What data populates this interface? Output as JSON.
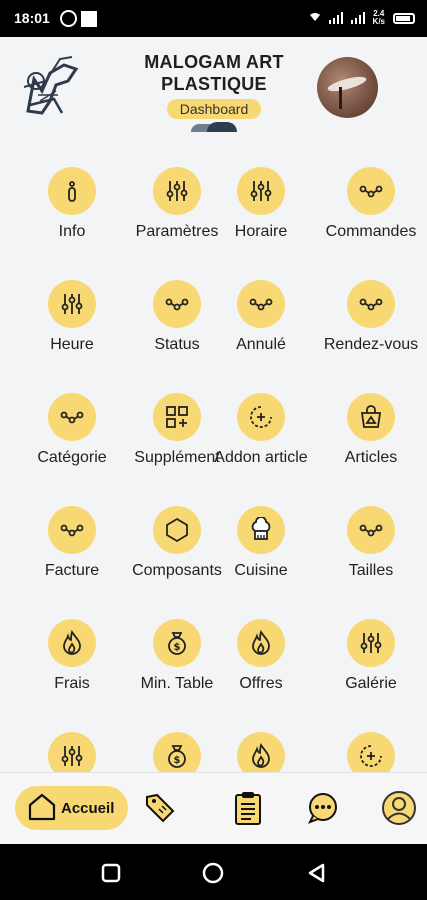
{
  "status_bar": {
    "time": "18:01",
    "net_speed_top": "2.4",
    "net_speed_bottom": "K/s"
  },
  "header": {
    "title": "MALOGAM ART PLASTIQUE",
    "subtitle": "Dashboard"
  },
  "grid": [
    {
      "label": "Info",
      "icon": "info-icon"
    },
    {
      "label": "Paramètres",
      "icon": "sliders-icon"
    },
    {
      "label": "Horaire",
      "icon": "sliders-icon"
    },
    {
      "label": "Commandes",
      "icon": "nodes-icon"
    },
    {
      "label": "Heure",
      "icon": "sliders-icon"
    },
    {
      "label": "Status",
      "icon": "nodes-icon"
    },
    {
      "label": "Annulé",
      "icon": "nodes-icon"
    },
    {
      "label": "Rendez-vous",
      "icon": "nodes-icon"
    },
    {
      "label": "Catégorie",
      "icon": "nodes-icon"
    },
    {
      "label": "Supplément",
      "icon": "grid-add-icon"
    },
    {
      "label": "Addon article",
      "icon": "circle-plus-icon"
    },
    {
      "label": "Articles",
      "icon": "shopping-bag-icon"
    },
    {
      "label": "Facture",
      "icon": "nodes-icon"
    },
    {
      "label": "Composants",
      "icon": "hexagon-icon"
    },
    {
      "label": "Cuisine",
      "icon": "chef-hat-icon"
    },
    {
      "label": "Tailles",
      "icon": "nodes-icon"
    },
    {
      "label": "Frais",
      "icon": "flame-icon"
    },
    {
      "label": "Min. Table",
      "icon": "money-bag-icon"
    },
    {
      "label": "Offres",
      "icon": "flame-icon"
    },
    {
      "label": "Galérie",
      "icon": "sliders-icon"
    },
    {
      "label": "",
      "icon": "sliders-icon"
    },
    {
      "label": "",
      "icon": "money-bag-icon"
    },
    {
      "label": "",
      "icon": "flame-icon"
    },
    {
      "label": "",
      "icon": "circle-plus-icon"
    }
  ],
  "bottom_nav": {
    "home_label": "Accueil",
    "items": [
      "home-icon",
      "tag-icon",
      "clipboard-icon",
      "chat-icon",
      "user-icon"
    ]
  },
  "colors": {
    "accent": "#f8d873",
    "background": "#f3f4f6",
    "text": "#222222"
  }
}
